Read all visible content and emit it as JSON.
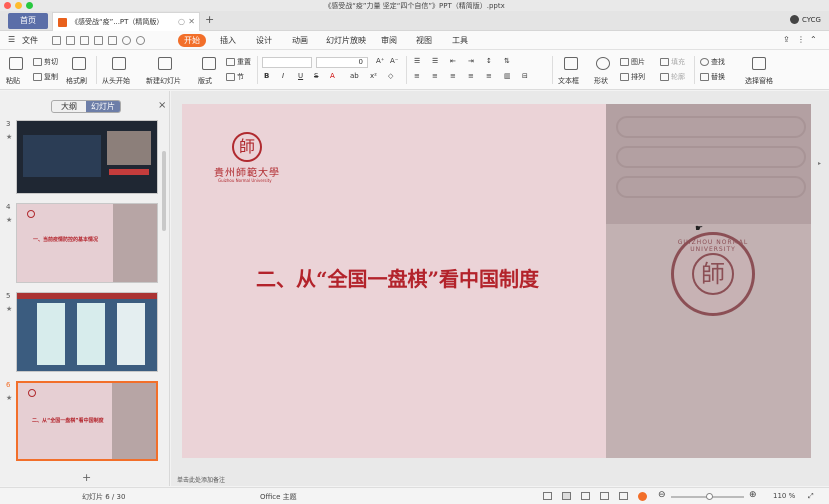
{
  "window": {
    "title": "《感受战“疫”力量 坚定“四个自信”》PPT（精简版）.pptx",
    "colors": {
      "close": "#ff5f57",
      "minimize": "#febc2e",
      "maximize": "#28c840"
    }
  },
  "tabs": {
    "home": "首页",
    "document": "《感受战“疫”...PT（精简版）",
    "close": "✕",
    "new": "+"
  },
  "user": {
    "name": "CYCG"
  },
  "menu": {
    "file": "文件",
    "items": [
      "开始",
      "插入",
      "设计",
      "动画",
      "幻灯片放映",
      "审阅",
      "视图",
      "工具"
    ],
    "active": "开始"
  },
  "ribbon": {
    "paste": "粘贴",
    "cut": "剪切",
    "copy": "复制",
    "format_painter": "格式刷",
    "from_start": "从头开始",
    "new_slide": "新建幻灯片",
    "layout": "版式",
    "section": "节",
    "reset": "重置",
    "textbox": "文本框",
    "shape": "形状",
    "arrange": "排列",
    "picture": "图片",
    "fill": "填充",
    "outline": "轮廓",
    "find": "查找",
    "replace": "替换",
    "select_pane": "选择窗格",
    "font_size_value": "0"
  },
  "panel": {
    "outline_tab": "大纲",
    "slides_tab": "幻灯片",
    "close": "×",
    "add": "+",
    "thumbnails": [
      {
        "num": "",
        "caption": ""
      },
      {
        "num": "4",
        "caption": "一、当前疫情防控的基本情况"
      },
      {
        "num": "5",
        "caption": ""
      },
      {
        "num": "6",
        "caption": "二、从“全国一盘棋”看中国制度"
      }
    ]
  },
  "slide": {
    "logo_char": "師",
    "logo_cn": "貴州師範大學",
    "logo_en": "Guizhou Normal University",
    "title": "二、从“全国一盘棋”看中国制度",
    "seal_char": "師",
    "seal_text": "GUIZHOU NORMAL UNIVERSITY",
    "brand_color": "#b3232b"
  },
  "notes": {
    "placeholder": "单击此处添加备注"
  },
  "status": {
    "slide_counter": "幻灯片 6 / 30",
    "theme": "Office 主题",
    "zoom": "110 %",
    "zoom_level": 110
  }
}
